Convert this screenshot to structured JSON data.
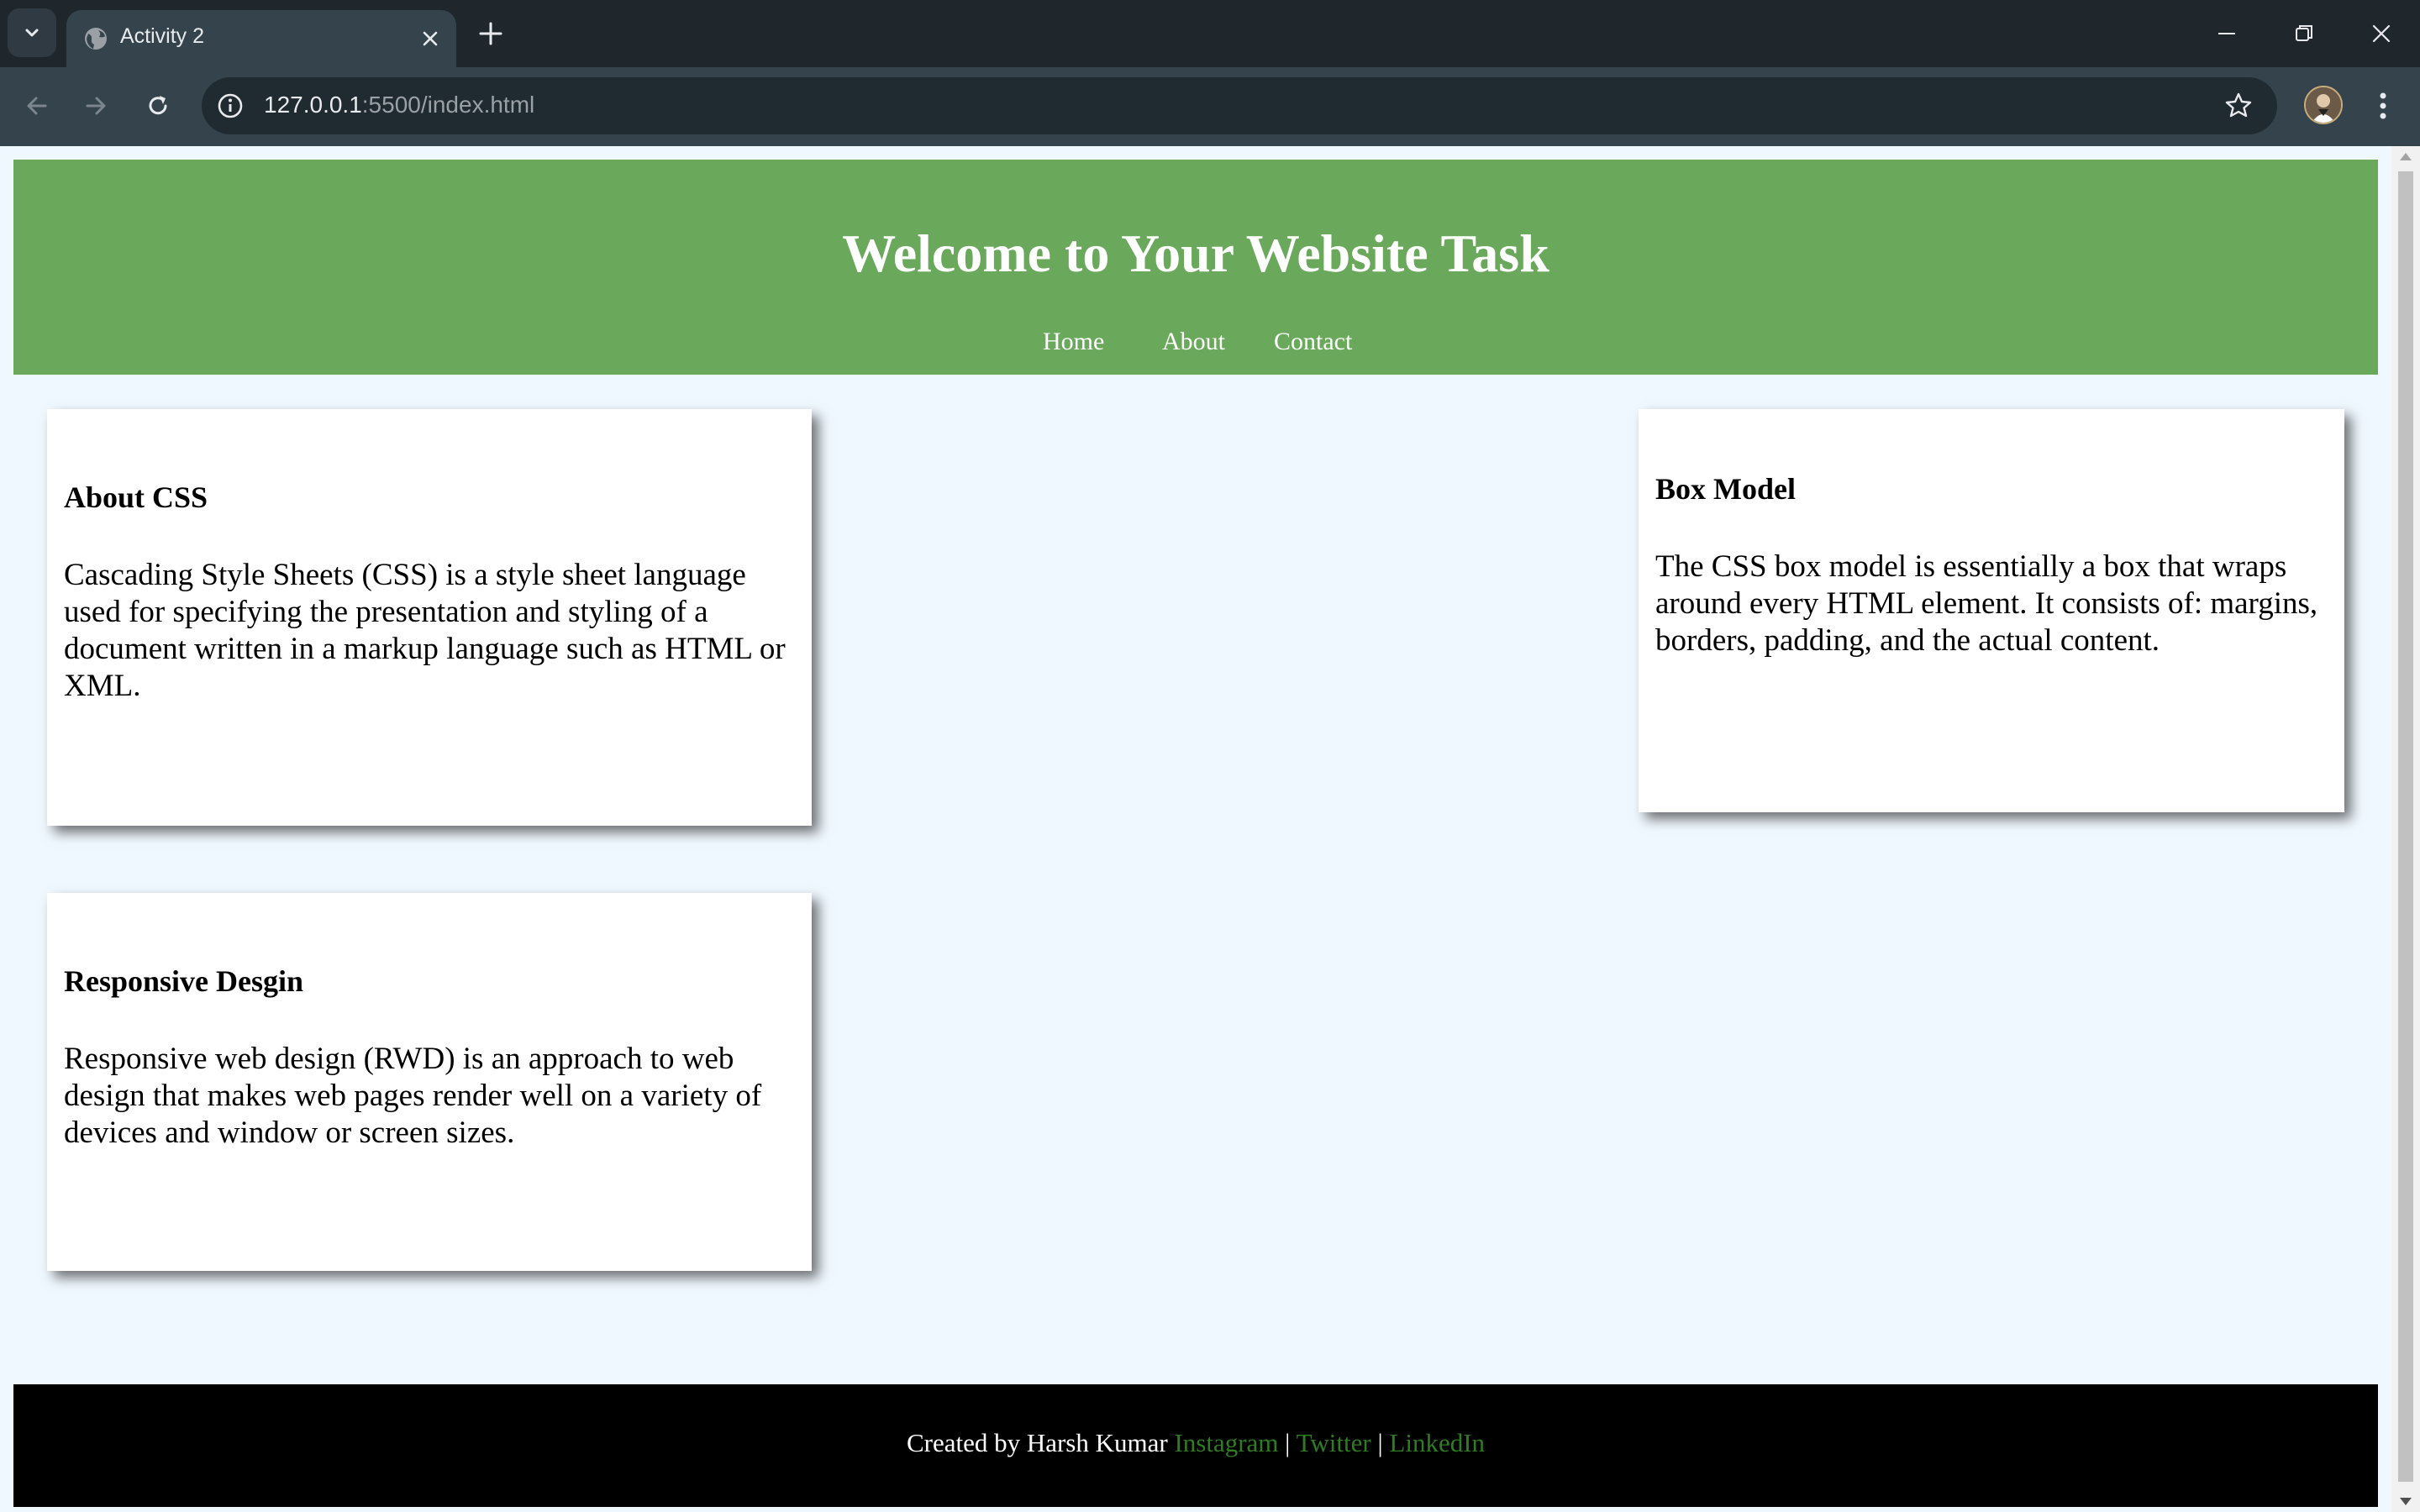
{
  "browser": {
    "tab_title": "Activity 2",
    "url_host": "127.0.0.1",
    "url_rest": ":5500/index.html"
  },
  "site": {
    "title": "Welcome to Your Website Task",
    "nav": [
      "Home",
      "About",
      "Contact"
    ]
  },
  "cards": [
    {
      "heading": "About CSS",
      "text": "Cascading Style Sheets (CSS) is a style sheet language used for specifying the presentation and styling of a document written in a markup language such as HTML or XML."
    },
    {
      "heading": "Box Model",
      "text": "The CSS box model is essentially a box that wraps around every HTML element. It consists of: margins, borders, padding, and the actual content."
    },
    {
      "heading": "Responsive Desgin",
      "text": "Responsive web design (RWD) is an approach to web design that makes web pages render well on a variety of devices and window or screen sizes."
    }
  ],
  "footer": {
    "credit": "Created by Harsh Kumar",
    "links": [
      "Instagram",
      "Twitter",
      "LinkedIn"
    ],
    "separator": "|"
  },
  "colors": {
    "header_bg": "#6aa85b",
    "page_bg": "#f0f8ff",
    "footer_bg": "#000000",
    "footer_link": "#2f7d22"
  }
}
